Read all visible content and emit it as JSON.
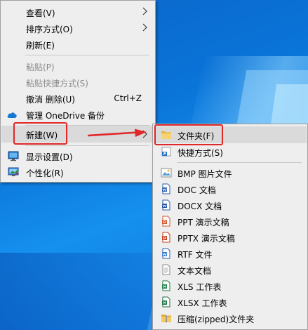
{
  "context_menu": {
    "items": [
      {
        "label": "查看(V)"
      },
      {
        "label": "排序方式(O)"
      },
      {
        "label": "刷新(E)"
      },
      {
        "label": "粘贴(P)"
      },
      {
        "label": "粘贴快捷方式(S)"
      },
      {
        "label": "撤消 删除(U)",
        "shortcut": "Ctrl+Z"
      },
      {
        "label": "管理 OneDrive 备份",
        "icon": "onedrive-cloud-icon"
      },
      {
        "label": "新建(W)"
      },
      {
        "label": "显示设置(D)",
        "icon": "display-settings-icon"
      },
      {
        "label": "个性化(R)",
        "icon": "personalize-icon"
      }
    ]
  },
  "new_submenu": {
    "items": [
      {
        "label": "文件夹(F)",
        "icon": "folder-icon"
      },
      {
        "label": "快捷方式(S)",
        "icon": "shortcut-icon"
      },
      {
        "label": "BMP 图片文件",
        "icon": "bmp-file-icon"
      },
      {
        "label": "DOC 文档",
        "icon": "doc-file-icon"
      },
      {
        "label": "DOCX 文档",
        "icon": "docx-file-icon"
      },
      {
        "label": "PPT 演示文稿",
        "icon": "ppt-file-icon"
      },
      {
        "label": "PPTX 演示文稿",
        "icon": "pptx-file-icon"
      },
      {
        "label": "RTF 文件",
        "icon": "rtf-file-icon"
      },
      {
        "label": "文本文档",
        "icon": "text-file-icon"
      },
      {
        "label": "XLS 工作表",
        "icon": "xls-file-icon"
      },
      {
        "label": "XLSX 工作表",
        "icon": "xlsx-file-icon"
      },
      {
        "label": "压缩(zipped)文件夹",
        "icon": "zip-folder-icon"
      }
    ]
  },
  "colors": {
    "annotation_red": "#e02828",
    "menu_background": "#eeeeee",
    "disabled_text": "#8a8a8a",
    "desktop_blue": "#0a74d8"
  }
}
